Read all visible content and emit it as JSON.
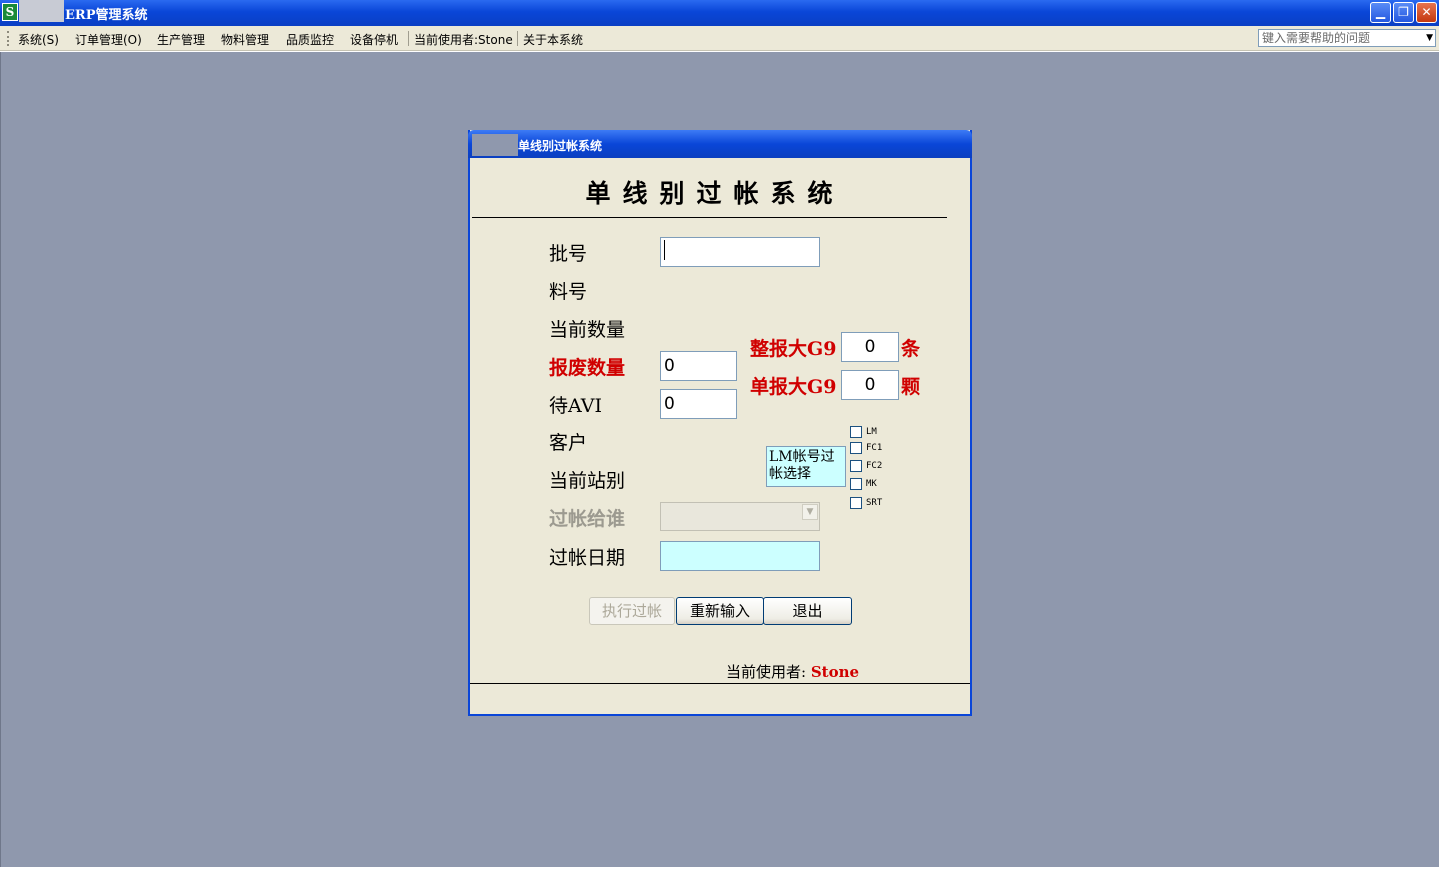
{
  "window": {
    "app_icon": "S",
    "title": "ERP管理系统",
    "minimize_icon": "▁",
    "restore_icon": "❐",
    "close_icon": "✕"
  },
  "menubar": {
    "items": [
      "系统(S)",
      "订单管理(O)",
      "生产管理",
      "物料管理",
      "品质监控",
      "设备停机",
      "当前使用者:Stone",
      "关于本系统"
    ],
    "help_placeholder": "键入需要帮助的问题",
    "help_arrow": "▼"
  },
  "dialog": {
    "title": "单线别过帐系统",
    "heading": "单线别过帐系统",
    "labels": {
      "batch": "批号",
      "material": "料号",
      "current_qty": "当前数量",
      "scrap_qty": "报废数量",
      "pending_avi": "待AVI",
      "customer": "客户",
      "current_station": "当前站别",
      "post_to": "过帐给谁",
      "post_date": "过帐日期",
      "whole_g9": "整报大G9",
      "single_g9": "单报大G9",
      "unit_strip": "条",
      "unit_piece": "颗"
    },
    "values": {
      "batch": "",
      "scrap_qty": "0",
      "pending_avi": "0",
      "whole_g9": "0",
      "single_g9": "0",
      "post_date": ""
    },
    "lm_account_select": "LM帐号过帐选择",
    "checkboxes": [
      "LM",
      "FC1",
      "FC2",
      "MK",
      "SRT"
    ],
    "combo_arrow": "▼",
    "buttons": {
      "execute": "执行过帐",
      "reset": "重新输入",
      "exit": "退出"
    },
    "current_user_label": "当前使用者:",
    "current_user_name": "Stone"
  }
}
